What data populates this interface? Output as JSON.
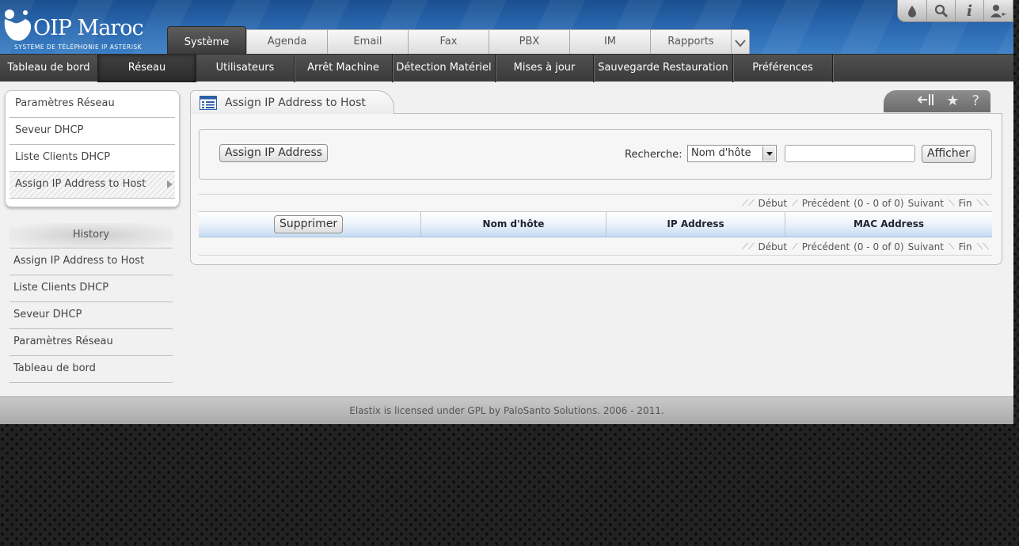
{
  "logo": {
    "brand": "OIP Maroc",
    "tagline": "SYSTÈME DE TÉLÉPHONIE IP ASTERISK"
  },
  "top_icons": [
    "drop-icon",
    "search-icon",
    "info-icon",
    "user-icon"
  ],
  "main_tabs": {
    "items": [
      "Système",
      "Agenda",
      "Email",
      "Fax",
      "PBX",
      "IM",
      "Rapports"
    ],
    "active": "Système"
  },
  "sub_menu": {
    "items": [
      "Tableau de bord",
      "Réseau",
      "Utilisateurs",
      "Arrêt Machine",
      "Détection Matériel",
      "Mises à jour",
      "Sauvegarde Restauration",
      "Préférences"
    ],
    "active": "Réseau"
  },
  "left_menu": {
    "items": [
      "Paramètres Réseau",
      "Seveur DHCP",
      "Liste Clients DHCP",
      "Assign IP Address to Host"
    ],
    "active": "Assign IP Address to Host"
  },
  "history": {
    "title": "History",
    "items": [
      "Assign IP Address to Host",
      "Liste Clients DHCP",
      "Seveur DHCP",
      "Paramètres Réseau",
      "Tableau de bord"
    ]
  },
  "panel": {
    "title": "Assign IP Address to Host"
  },
  "filter": {
    "assign_button": "Assign IP Address",
    "search_label": "Recherche:",
    "search_field_value": "Nom d'hôte",
    "search_input_value": "",
    "show_button": "Afficher"
  },
  "pager": {
    "first": "Début",
    "previous": "Précédent",
    "range": "(0 - 0 of 0)",
    "next": "Suivant",
    "last": "Fin"
  },
  "table": {
    "delete_button": "Supprimer",
    "columns": [
      "Nom d'hôte",
      "IP Address",
      "MAC Address"
    ],
    "rows": []
  },
  "footer": {
    "text": "Elastix is licensed under GPL by PaloSanto Solutions. 2006 - 2011."
  }
}
